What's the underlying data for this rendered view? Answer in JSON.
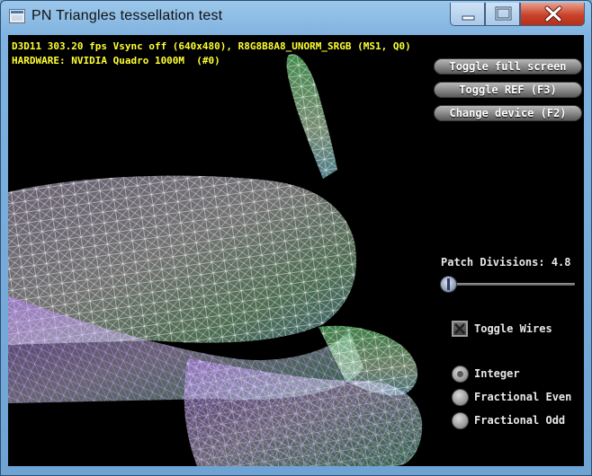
{
  "window": {
    "title": "PN Triangles tessellation test"
  },
  "stats": {
    "line1": "D3D11 303.20 fps Vsync off (640x480), R8G8B8A8_UNORM_SRGB (MS1, Q0)",
    "line2": "HARDWARE: NVIDIA Quadro 1000M  (#0)"
  },
  "buttons": {
    "toggle_full_screen": "Toggle full screen",
    "toggle_ref": "Toggle REF (F3)",
    "change_device": "Change device (F2)"
  },
  "patch": {
    "label": "Patch Divisions: 4.8",
    "slider_value": 4.8
  },
  "wires": {
    "label": "Toggle Wires",
    "checked": true
  },
  "partitioning": [
    {
      "label": "Integer",
      "selected": true
    },
    {
      "label": "Fractional Even",
      "selected": false
    },
    {
      "label": "Fractional Odd",
      "selected": false
    }
  ],
  "colors": {
    "stats_text": "#ffff33",
    "wire_mesh": [
      "#ffffff",
      "#b57cff",
      "#7cff8f",
      "#63d7ff"
    ]
  },
  "icons": {
    "app": "window-app-icon",
    "minimize": "minimize-icon",
    "maximize": "maximize-icon",
    "close": "close-icon"
  }
}
